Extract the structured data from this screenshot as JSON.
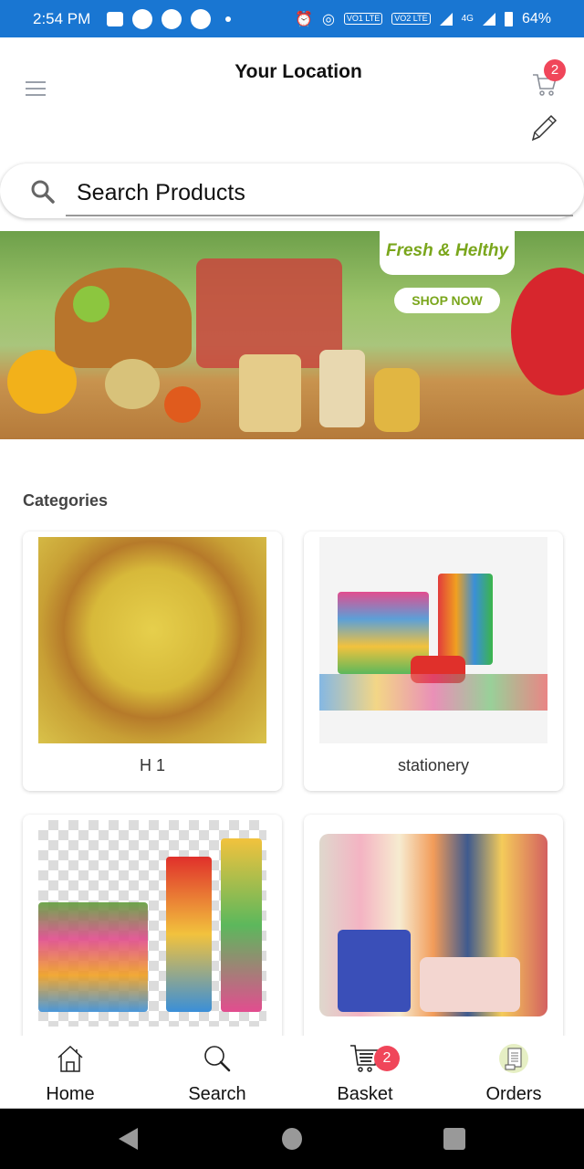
{
  "status_bar": {
    "time": "2:54 PM",
    "battery": "64%",
    "network": "4G",
    "sim1": "VO1 LTE",
    "sim2": "VO2 LTE"
  },
  "header": {
    "title": "Your Location",
    "cart_count": "2"
  },
  "search": {
    "placeholder": "Search Products"
  },
  "banner": {
    "tagline": "Fresh & Helthy",
    "cta_label": "SHOP NOW"
  },
  "categories": {
    "title": "Categories",
    "items": [
      {
        "label": "H 1",
        "image": "millet-bowl"
      },
      {
        "label": "stationery",
        "image": "stationery-supplies"
      },
      {
        "label": "",
        "image": "office-supplies"
      },
      {
        "label": "",
        "image": "personal-care-products"
      }
    ]
  },
  "bottom_nav": {
    "items": [
      {
        "label": "Home",
        "icon": "home-icon"
      },
      {
        "label": "Search",
        "icon": "search-icon"
      },
      {
        "label": "Basket",
        "icon": "basket-icon",
        "badge": "2"
      },
      {
        "label": "Orders",
        "icon": "orders-icon"
      }
    ]
  },
  "colors": {
    "status_bar": "#1976d2",
    "badge": "#f0465a",
    "banner_accent": "#7aa61c"
  }
}
